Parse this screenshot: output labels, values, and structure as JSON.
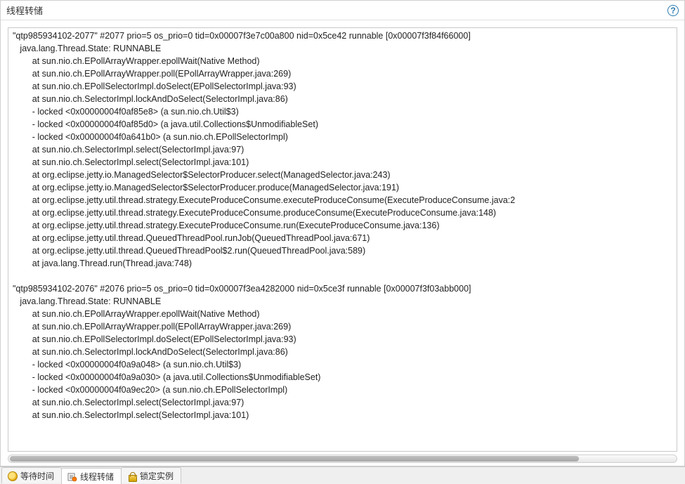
{
  "panel": {
    "title": "线程转储",
    "help_tooltip": "?"
  },
  "tabs": [
    {
      "label": "等待时间"
    },
    {
      "label": "线程转储"
    },
    {
      "label": "锁定实例"
    }
  ],
  "dump": {
    "threads": [
      {
        "header": "\"qtp985934102-2077\" #2077 prio=5 os_prio=0 tid=0x00007f3e7c00a800 nid=0x5ce42 runnable [0x00007f3f84f66000]",
        "state": "   java.lang.Thread.State: RUNNABLE",
        "stack": [
          "        at sun.nio.ch.EPollArrayWrapper.epollWait(Native Method)",
          "        at sun.nio.ch.EPollArrayWrapper.poll(EPollArrayWrapper.java:269)",
          "        at sun.nio.ch.EPollSelectorImpl.doSelect(EPollSelectorImpl.java:93)",
          "        at sun.nio.ch.SelectorImpl.lockAndDoSelect(SelectorImpl.java:86)",
          "        - locked <0x00000004f0af85e8> (a sun.nio.ch.Util$3)",
          "        - locked <0x00000004f0af85d0> (a java.util.Collections$UnmodifiableSet)",
          "        - locked <0x00000004f0a641b0> (a sun.nio.ch.EPollSelectorImpl)",
          "        at sun.nio.ch.SelectorImpl.select(SelectorImpl.java:97)",
          "        at sun.nio.ch.SelectorImpl.select(SelectorImpl.java:101)",
          "        at org.eclipse.jetty.io.ManagedSelector$SelectorProducer.select(ManagedSelector.java:243)",
          "        at org.eclipse.jetty.io.ManagedSelector$SelectorProducer.produce(ManagedSelector.java:191)",
          "        at org.eclipse.jetty.util.thread.strategy.ExecuteProduceConsume.executeProduceConsume(ExecuteProduceConsume.java:2",
          "        at org.eclipse.jetty.util.thread.strategy.ExecuteProduceConsume.produceConsume(ExecuteProduceConsume.java:148)",
          "        at org.eclipse.jetty.util.thread.strategy.ExecuteProduceConsume.run(ExecuteProduceConsume.java:136)",
          "        at org.eclipse.jetty.util.thread.QueuedThreadPool.runJob(QueuedThreadPool.java:671)",
          "        at org.eclipse.jetty.util.thread.QueuedThreadPool$2.run(QueuedThreadPool.java:589)",
          "        at java.lang.Thread.run(Thread.java:748)"
        ]
      },
      {
        "header": "\"qtp985934102-2076\" #2076 prio=5 os_prio=0 tid=0x00007f3ea4282000 nid=0x5ce3f runnable [0x00007f3f03abb000]",
        "state": "   java.lang.Thread.State: RUNNABLE",
        "stack": [
          "        at sun.nio.ch.EPollArrayWrapper.epollWait(Native Method)",
          "        at sun.nio.ch.EPollArrayWrapper.poll(EPollArrayWrapper.java:269)",
          "        at sun.nio.ch.EPollSelectorImpl.doSelect(EPollSelectorImpl.java:93)",
          "        at sun.nio.ch.SelectorImpl.lockAndDoSelect(SelectorImpl.java:86)",
          "        - locked <0x00000004f0a9a048> (a sun.nio.ch.Util$3)",
          "        - locked <0x00000004f0a9a030> (a java.util.Collections$UnmodifiableSet)",
          "        - locked <0x00000004f0a9ec20> (a sun.nio.ch.EPollSelectorImpl)",
          "        at sun.nio.ch.SelectorImpl.select(SelectorImpl.java:97)",
          "        at sun.nio.ch.SelectorImpl.select(SelectorImpl.java:101)"
        ]
      }
    ]
  }
}
